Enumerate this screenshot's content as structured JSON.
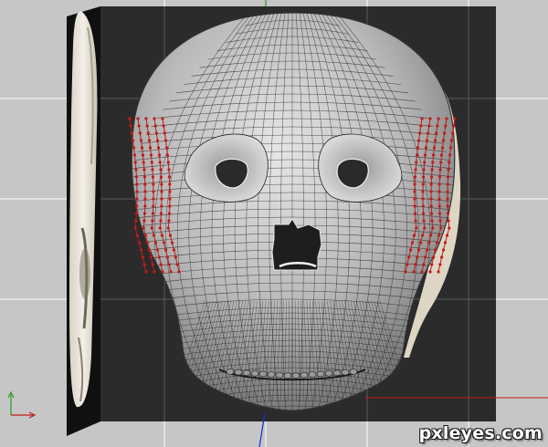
{
  "viewport": {
    "background_color": "#c6c6c6",
    "grid_color": "#ffffff",
    "backdrop_color": "#2b2b2b",
    "axis_x_color": "#c21a1a",
    "axis_y_color": "#2a9a2a",
    "axis_z_color": "#1a2ad6"
  },
  "model": {
    "mesh_fill": "#bcbcbc",
    "wire_color": "#222222",
    "selected_vertex_color": "#c41a1a",
    "reference_plane_color": "#e8e4dc"
  },
  "icons": {
    "axis_gizmo": "axis-gizmo-icon"
  },
  "watermark": {
    "text": "pxleyes.com"
  }
}
